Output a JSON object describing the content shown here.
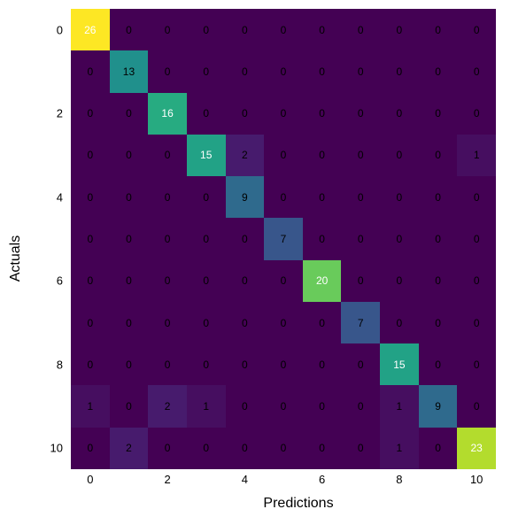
{
  "chart_data": {
    "type": "heatmap",
    "title": "",
    "xlabel": "Predictions",
    "ylabel": "Actuals",
    "x_categories": [
      "0",
      "1",
      "2",
      "3",
      "4",
      "5",
      "6",
      "7",
      "8",
      "9",
      "10"
    ],
    "y_categories": [
      "0",
      "1",
      "2",
      "3",
      "4",
      "5",
      "6",
      "7",
      "8",
      "9",
      "10"
    ],
    "x_ticks_shown": [
      "0",
      "2",
      "4",
      "6",
      "8",
      "10"
    ],
    "y_ticks_shown": [
      "0",
      "2",
      "4",
      "6",
      "8",
      "10"
    ],
    "values": [
      [
        26,
        0,
        0,
        0,
        0,
        0,
        0,
        0,
        0,
        0,
        0
      ],
      [
        0,
        13,
        0,
        0,
        0,
        0,
        0,
        0,
        0,
        0,
        0
      ],
      [
        0,
        0,
        16,
        0,
        0,
        0,
        0,
        0,
        0,
        0,
        0
      ],
      [
        0,
        0,
        0,
        15,
        2,
        0,
        0,
        0,
        0,
        0,
        1
      ],
      [
        0,
        0,
        0,
        0,
        9,
        0,
        0,
        0,
        0,
        0,
        0
      ],
      [
        0,
        0,
        0,
        0,
        0,
        7,
        0,
        0,
        0,
        0,
        0
      ],
      [
        0,
        0,
        0,
        0,
        0,
        0,
        20,
        0,
        0,
        0,
        0
      ],
      [
        0,
        0,
        0,
        0,
        0,
        0,
        0,
        7,
        0,
        0,
        0
      ],
      [
        0,
        0,
        0,
        0,
        0,
        0,
        0,
        0,
        15,
        0,
        0
      ],
      [
        1,
        0,
        2,
        1,
        0,
        0,
        0,
        0,
        1,
        9,
        0
      ],
      [
        0,
        2,
        0,
        0,
        0,
        0,
        0,
        0,
        1,
        0,
        23
      ]
    ],
    "vmin": 0,
    "vmax": 26,
    "colormap": "viridis"
  }
}
